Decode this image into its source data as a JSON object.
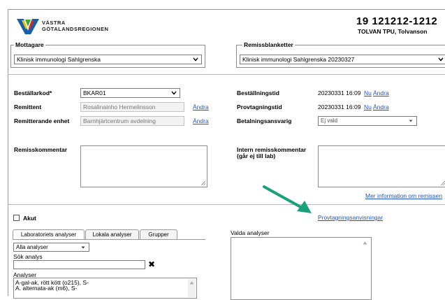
{
  "header": {
    "org_line1": "VÄSTRA",
    "org_line2": "GÖTALANDSREGIONEN",
    "patient_id": "19 121212-1212",
    "patient_name": "TOLVAN TPU, Tolvanson"
  },
  "mottagare": {
    "legend": "Mottagare",
    "selected": "Klinisk immunologi Sahlgrenska"
  },
  "remissblanketter": {
    "legend": "Remissblanketter",
    "selected": "Klinisk immunologi Sahlgrenska 20230327"
  },
  "left_fields": {
    "bestallarkod_label": "Beställarkod*",
    "bestallarkod_value": "BKAR01",
    "remittent_label": "Remittent",
    "remittent_value": "Rosalinainho Hermelinsson",
    "remittent_action": "Ändra",
    "remitterande_enhet_label": "Remitterande enhet",
    "remitterande_enhet_value": "Barnhjärtcentrum avdelning",
    "remitterande_enhet_action": "Ändra",
    "remisskommentar_label": "Remisskommentar"
  },
  "right_fields": {
    "bestallningstid_label": "Beställningstid",
    "bestallningstid_value": "20230331 16:09",
    "bestallningstid_nu": "Nu",
    "bestallningstid_andra": "Ändra",
    "provtagningstid_label": "Provtagningstid",
    "provtagningstid_value": "20230331 16:09",
    "provtagningstid_nu": "Nu",
    "provtagningstid_andra": "Ändra",
    "betalningsansvarig_label": "Betalningsansvarig",
    "betalningsansvarig_value": "Ej vald",
    "intern_kommentar_label_1": "Intern remisskommentar",
    "intern_kommentar_label_2": "(går ej till lab)",
    "mer_information_link": "Mer information om remissen",
    "provtagningsanvisningar_link": "Provtagningsanvisningar"
  },
  "analyses": {
    "akut_label": "Akut",
    "tabs": [
      "Laboratoriets analyser",
      "Lokala analyser",
      "Grupper"
    ],
    "filter_selected": "Alla analyser",
    "sok_label": "Sök analys",
    "sok_value": "",
    "clear_icon": "✖",
    "analyser_label": "Analyser",
    "list_items": [
      "A-gal-ak, rött kött (o215), S-",
      "A. alternata-ak (m6), S-"
    ],
    "valda_label": "Valda analyser"
  },
  "colors": {
    "link": "#1f56c4",
    "arrow": "#1aa07a",
    "logo_blue": "#1560a8",
    "logo_green": "#3aa935",
    "logo_yellow": "#f5c400",
    "logo_red": "#d42a2a"
  }
}
